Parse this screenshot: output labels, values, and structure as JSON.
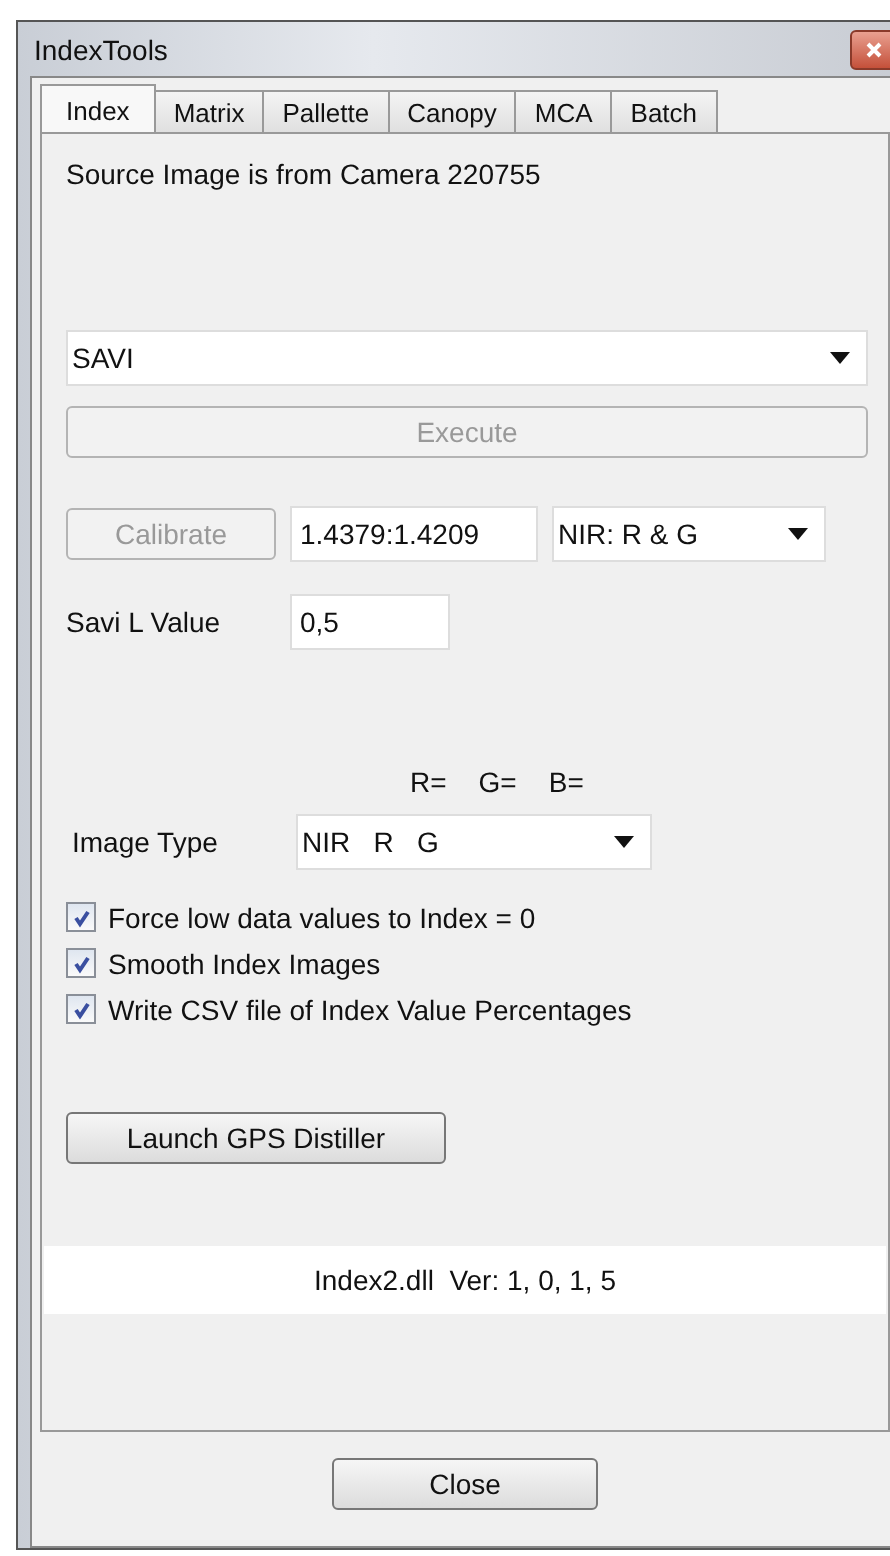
{
  "window": {
    "title": "IndexTools"
  },
  "tabs": [
    {
      "label": "Index",
      "selected": true
    },
    {
      "label": "Matrix",
      "selected": false
    },
    {
      "label": "Pallette",
      "selected": false
    },
    {
      "label": "Canopy",
      "selected": false
    },
    {
      "label": "MCA",
      "selected": false
    },
    {
      "label": "Batch",
      "selected": false
    }
  ],
  "source_text": "Source Image is from Camera 220755",
  "index_select": {
    "value": "SAVI"
  },
  "execute_button": {
    "label": "Execute",
    "disabled": true
  },
  "calibrate_button": {
    "label": "Calibrate",
    "disabled": true
  },
  "calibration_field": {
    "value": "1.4379:1.4209"
  },
  "band_select": {
    "value": "NIR: R & G"
  },
  "savi_l": {
    "label": "Savi L Value",
    "value": "0,5"
  },
  "channel_headers": [
    "R=",
    "G=",
    "B="
  ],
  "image_type": {
    "label": "Image Type",
    "value": "NIR   R   G"
  },
  "checkboxes": [
    {
      "label": "Force low data values to Index = 0",
      "checked": true
    },
    {
      "label": "Smooth Index Images",
      "checked": true
    },
    {
      "label": "Write CSV file of Index Value Percentages",
      "checked": true
    }
  ],
  "gps_button": {
    "label": "Launch GPS Distiller"
  },
  "version": "Index2.dll  Ver: 1, 0, 1, 5",
  "close_button": {
    "label": "Close"
  }
}
